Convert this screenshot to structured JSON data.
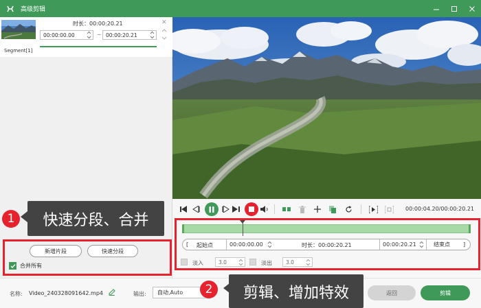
{
  "window": {
    "title": "高级剪辑",
    "accent_color": "#3f9a5a",
    "controls": [
      "minimize-icon",
      "maximize-icon",
      "close-icon"
    ]
  },
  "segment_list": {
    "duration_label": "时长：00:00:20.21",
    "start_time": "00:00:00.00",
    "end_time": "00:00:20.21",
    "separator": "~",
    "segment_name": "Segment[1]"
  },
  "left_actions": {
    "callout_number": "1",
    "callout_text": "快速分段、合并",
    "new_segment_label": "新增片段",
    "quick_split_label": "快速分段",
    "merge_all_label": "合并所有",
    "merge_all_checked": true
  },
  "playback": {
    "current_total_time": "00:00:04.20/00:00:20.21"
  },
  "trim": {
    "start_button": "起始点",
    "start_value": "00:00:00.00",
    "duration_label": "时长：00:00:20.21",
    "end_value": "00:00:20.21",
    "end_button": "结束点",
    "fade_in_label": "淡入",
    "fade_in_value": "3.0",
    "fade_out_label": "淡出",
    "fade_out_value": "3.0",
    "playhead_progress": 0.2079
  },
  "annotation2": {
    "number": "2",
    "text": "剪辑、增加特效"
  },
  "bottom": {
    "name_label": "名称:",
    "file_name": "Video_240328091642.mp4",
    "output_label": "输出:",
    "output_value": "自动,Auto",
    "back_label": "返回",
    "cut_label": "剪辑"
  },
  "colors": {
    "accent": "#3f9a5a",
    "annotation_red": "#e5222e",
    "callout_bg": "#434343",
    "timeline_fill": "#a6d9a6"
  }
}
